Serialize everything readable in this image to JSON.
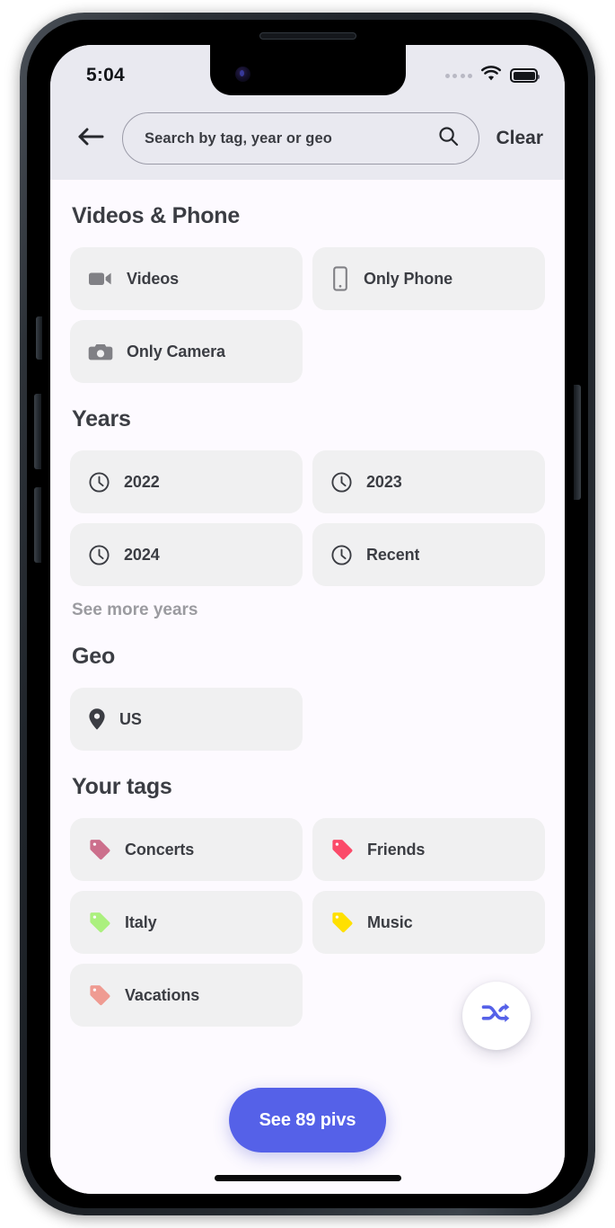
{
  "status_bar": {
    "time": "5:04",
    "signal_icon": "signal-dots-icon",
    "wifi_icon": "wifi-icon",
    "battery_icon": "battery-full-icon"
  },
  "header": {
    "back_icon": "arrow-left-icon",
    "search_placeholder": "Search by tag, year or geo",
    "search_value": "",
    "search_icon": "search-icon",
    "clear_label": "Clear"
  },
  "sections": [
    {
      "title": "Videos & Phone",
      "chips": [
        {
          "label": "Videos",
          "icon": "video-camera-icon"
        },
        {
          "label": "Only Phone",
          "icon": "smartphone-icon"
        },
        {
          "label": "Only Camera",
          "icon": "camera-icon"
        }
      ]
    },
    {
      "title": "Years",
      "chips": [
        {
          "label": "2022",
          "icon": "clock-icon"
        },
        {
          "label": "2023",
          "icon": "clock-icon"
        },
        {
          "label": "2024",
          "icon": "clock-icon"
        },
        {
          "label": "Recent",
          "icon": "clock-icon"
        }
      ],
      "see_more_label": "See more years"
    },
    {
      "title": "Geo",
      "chips": [
        {
          "label": "US",
          "icon": "location-pin-icon"
        }
      ]
    },
    {
      "title": "Your tags",
      "chips": [
        {
          "label": "Concerts",
          "icon": "tag-icon",
          "color": "#cc6f8c"
        },
        {
          "label": "Friends",
          "icon": "tag-icon",
          "color": "#fb4a69"
        },
        {
          "label": "Italy",
          "icon": "tag-icon",
          "color": "#abf07e"
        },
        {
          "label": "Music",
          "icon": "tag-icon",
          "color": "#ffe000"
        },
        {
          "label": "Vacations",
          "icon": "tag-icon",
          "color": "#ef9b92"
        }
      ]
    }
  ],
  "floating": {
    "shuffle_icon": "shuffle-icon",
    "shuffle_color": "#5561e8",
    "see_pivs_label": "See 89 pivs",
    "see_pivs_color": "#5561e8"
  },
  "colors": {
    "header_bg": "#e9e9f0",
    "content_bg": "#fdfaff",
    "chip_bg": "#f0f0f1",
    "text_primary": "#3b3d43",
    "text_muted": "#9b9ba0",
    "accent": "#5561e8"
  }
}
